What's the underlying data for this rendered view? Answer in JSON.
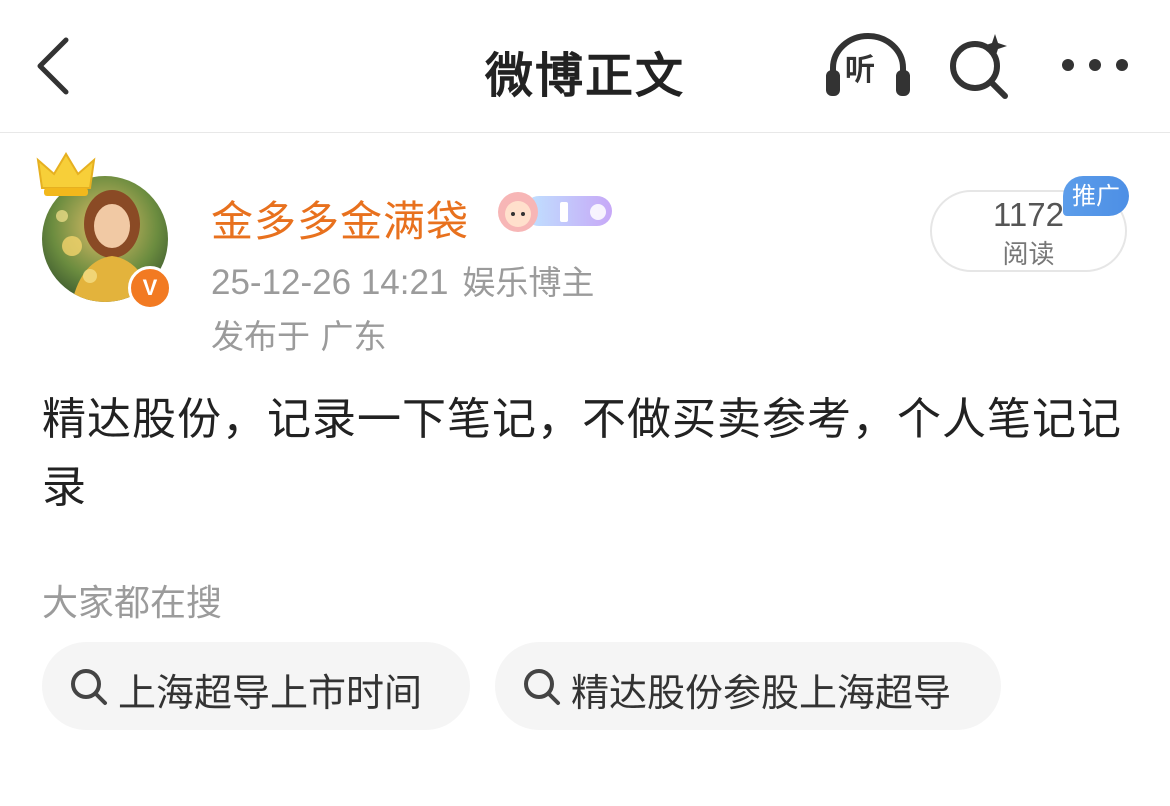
{
  "header": {
    "title": "微博正文",
    "listen_label": "听"
  },
  "post": {
    "author": {
      "name": "金多多金满袋",
      "verified_badge": "V"
    },
    "time": "25-12-26 14:21",
    "role": "娱乐博主",
    "location": "发布于 广东",
    "read_count": "1172",
    "read_label": "阅读",
    "promo_tag": "推广",
    "content": "精达股份，记录一下笔记，不做买卖参考，个人笔记记录"
  },
  "search_section": {
    "heading": "大家都在搜",
    "items": [
      {
        "label": "上海超导上市时间"
      },
      {
        "label": "精达股份参股上海超导"
      }
    ]
  },
  "colors": {
    "username": "#e8711e",
    "muted": "#9b9b9b",
    "promo": "#4d8fe5",
    "chip_bg": "#f5f5f5"
  },
  "icons": [
    "back-arrow-icon",
    "headphones-icon",
    "search-sparkle-icon",
    "more-dots-icon",
    "crown-icon",
    "verified-v-icon",
    "member-badge-icon",
    "search-icon"
  ]
}
